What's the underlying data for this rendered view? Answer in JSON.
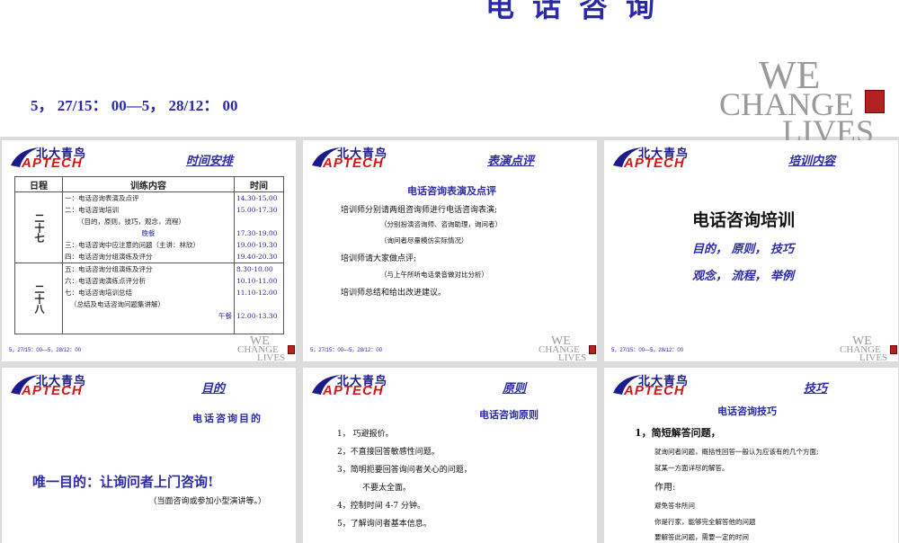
{
  "header": {
    "title": "电话咨询",
    "date_line": "5， 27/15： 00—5， 28/12： 00"
  },
  "brand": {
    "we": "WE",
    "change": "CHANGE",
    "lives": "LIVES",
    "logo_cn": "北大青鸟",
    "logo_en": "APTECH",
    "footer_date": "5，27/15：00—5，28/12：00"
  },
  "colors": {
    "accent": "#2a2aa8",
    "logo_red": "#d01818",
    "seal": "#b22222"
  },
  "slides": {
    "schedule": {
      "title": "时间安排",
      "headers": {
        "day": "日程",
        "content": "训练内容",
        "time": "时间"
      },
      "day1": "二十七",
      "day2": "二十八",
      "rows1": [
        {
          "content": "一：电话咨询表演及点评",
          "time": "14.30-15.00"
        },
        {
          "content": "二：电话咨询培训",
          "time": "15.00-17.30"
        },
        {
          "content": "（目的，原则，技巧，观念，流程）",
          "time": ""
        },
        {
          "content": "晚餐",
          "time": "17.30-19.00"
        },
        {
          "content": "三：电话咨询中应注意的问题（主讲：林欣）",
          "time": "19.00-19.30"
        },
        {
          "content": "四：电话咨询分组演练及评分",
          "time": "19.40-20.30"
        }
      ],
      "rows2": [
        {
          "content": "五：电话咨询分组演练及评分",
          "time": "8.30-10.00"
        },
        {
          "content": "六：电话咨询演练点评分析",
          "time": "10.10-11.00"
        },
        {
          "content": "七：电话咨询培训总结",
          "time": "11.10-12.00"
        },
        {
          "content": "（总结及电话咨询问题集讲解）",
          "time": ""
        },
        {
          "content": "午餐",
          "time": "12.00-13.30"
        }
      ]
    },
    "performance": {
      "title": "表演点评",
      "heading": "电话咨询表演及点评",
      "line1": "培训师分别请两组咨询师进行电话咨询表演;",
      "line2": "（分别扮演咨询师、咨询助理，询问者）",
      "line3": "（询问者尽量模仿实际情况）",
      "line4": "培训师请大家做点评;",
      "line5": "（与上午所听电话录音做对比分析）",
      "line6": "培训师总结和给出改进建议。"
    },
    "content": {
      "title": "培训内容",
      "heading": "电话咨询培训",
      "line1": "目的， 原则， 技巧",
      "line2": "观念， 流程， 举例"
    },
    "purpose": {
      "title": "目的",
      "heading": "电话咨询目的",
      "main": "唯一目的：让询问者上门咨询!",
      "note": "（当面咨询或参加小型演讲等。）"
    },
    "principle": {
      "title": "原则",
      "heading": "电话咨询原则",
      "items": [
        "1，  巧避报价。",
        "2，不直接回答敏感性问题。",
        "3，简明扼要回答询问者关心的问题，",
        "不要太全面。",
        "4，控制时间 4-7 分钟。",
        "5，了解询问者基本信息。"
      ]
    },
    "skill": {
      "title": "技巧",
      "heading": "电话咨询技巧",
      "point1": "1，简短解答问题，",
      "desc1": "就询问者问题，概括性回答一般认为应该有的几个方面;",
      "desc2": "就某一方面详尽的解答。",
      "effect": "作用:",
      "e1": "避免答非所问",
      "e2": "你是行家，能够完全解答他的问题",
      "e3": "要解答此问题，需要一定的时间"
    }
  }
}
